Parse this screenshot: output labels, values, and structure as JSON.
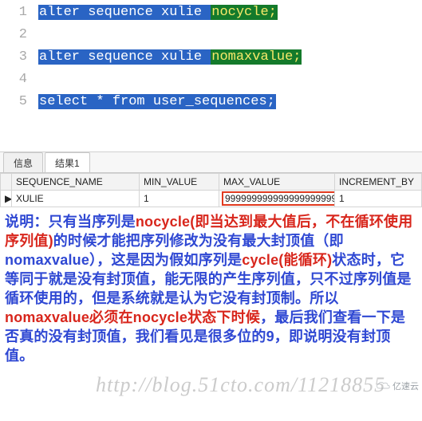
{
  "editor": {
    "lines": [
      {
        "n": "1",
        "pre": "alter sequence xulie ",
        "kw": "nocycle;",
        "post": ""
      },
      {
        "n": "2",
        "pre": "",
        "kw": "",
        "post": ""
      },
      {
        "n": "3",
        "pre": "alter sequence xulie ",
        "kw": "nomaxvalue;",
        "post": ""
      },
      {
        "n": "4",
        "pre": "",
        "kw": "",
        "post": ""
      },
      {
        "n": "5",
        "pre": "select * from user_sequences;",
        "kw": "",
        "post": ""
      }
    ]
  },
  "tabs": {
    "info": "信息",
    "results": "结果1"
  },
  "grid": {
    "headers": {
      "seq": "SEQUENCE_NAME",
      "min": "MIN_VALUE",
      "max": "MAX_VALUE",
      "inc": "INCREMENT_BY"
    },
    "row": {
      "marker": "▶",
      "seq": "XULIE",
      "min": "1",
      "max": "9999999999999999999999",
      "inc": "1"
    }
  },
  "explain": {
    "p1a": "说明：只有当序列是",
    "p1red1": "nocycle(即当达到最大值后，不在循环使用序列值)",
    "p1b": "的时候才能把序列修改为没有最大封顶值（即nomaxvalue），这是因为假如序列是",
    "p1red2": "cycle(能循环)",
    "p1c": "状态时，它等同于就是没有封顶值，能无限的产生序列值，只不过序列值是循环使用的，但是系统就是认为它没有封顶制。所以",
    "p1red3": "nomaxvalue必须在nocycle状态下时候",
    "p1d": "，最后我们查看一下是否真的没有封顶值，我们看见是很多位的9，即说明没有封顶值。"
  },
  "watermark": "http://blog.51cto.com/11218855",
  "logo_text": "亿速云"
}
